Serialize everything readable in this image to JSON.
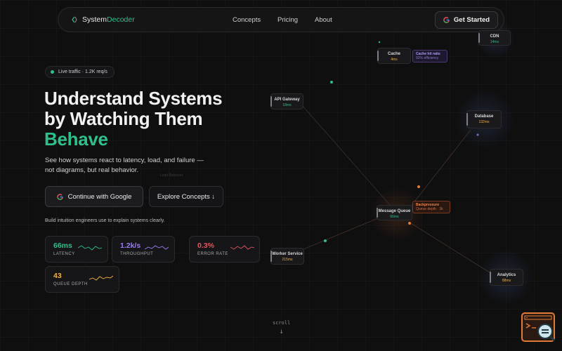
{
  "nav": {
    "brand_part1": "System",
    "brand_part2": "Decoder",
    "links": [
      "Concepts",
      "Pricing",
      "About"
    ],
    "cta": "Get Started"
  },
  "hero": {
    "pill": "Live traffic · 1.2K req/s",
    "title_line1": "Understand Systems",
    "title_line2": "by Watching Them",
    "title_accent": "Behave",
    "subtitle_line1": "See how systems react to latency, load, and failure —",
    "subtitle_line2": "not diagrams, but real behavior.",
    "btn_google": "Continue with Google",
    "btn_explore": "Explore Concepts ↓",
    "tagline": "Build intuition engineers use to explain systems clearly."
  },
  "metrics": [
    {
      "value": "66ms",
      "label": "LATENCY",
      "color": "#2fbf8a"
    },
    {
      "value": "1.2k/s",
      "label": "THROUGHPUT",
      "color": "#9b7cf0"
    },
    {
      "value": "0.3%",
      "label": "ERROR RATE",
      "color": "#e0555f"
    },
    {
      "value": "43",
      "label": "QUEUE DEPTH",
      "color": "#f0b040"
    }
  ],
  "nodes": {
    "cdn": {
      "name": "CDN",
      "value": "14ms"
    },
    "cache": {
      "name": "Cache",
      "value": "4ms"
    },
    "api": {
      "name": "API Gateway",
      "value": "18ms"
    },
    "db": {
      "name": "Database",
      "value": "132ms"
    },
    "mq": {
      "name": "Message Queue",
      "value": "66ms"
    },
    "worker": {
      "name": "Worker Service",
      "value": "215ms"
    },
    "analytics": {
      "name": "Analytics",
      "value": "88ms"
    }
  },
  "tooltips": {
    "cache_title": "Cache hit ratio",
    "cache_sub": "92% efficiency",
    "bp_title": "Backpressure",
    "bp_sub": "Queue depth · 3k"
  },
  "ghost_label": "Load Balancer",
  "scroll": "scroll",
  "scroll_arrow": "↓",
  "colors": {
    "accent": "#2fbf8a",
    "purple": "#9b7cf0",
    "red": "#e0555f",
    "amber": "#f0b040",
    "orange": "#e07a3a"
  },
  "icons": [
    "logo-icon",
    "google-icon",
    "terminal-icon",
    "search-icon"
  ]
}
